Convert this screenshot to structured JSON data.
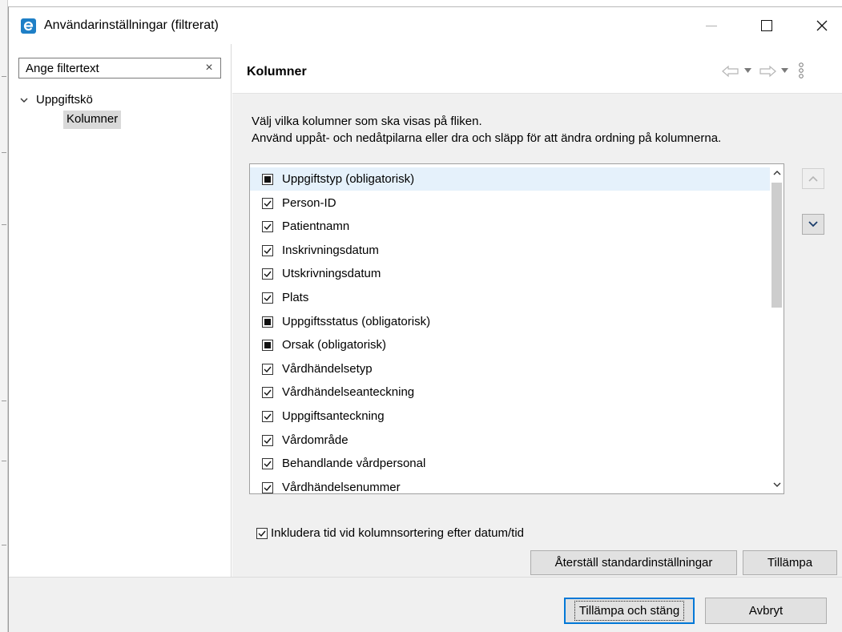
{
  "window": {
    "title": "Användarinställningar (filtrerat)",
    "accent_color": "#1e7fc6"
  },
  "sidebar": {
    "filter": {
      "value": "",
      "placeholder": "Ange filtertext",
      "clear_icon": "×"
    },
    "tree": {
      "root_label": "Uppgiftskö",
      "child_label": "Kolumner",
      "child_selected": true
    }
  },
  "page": {
    "title": "Kolumner",
    "description_line1": "Välj vilka kolumner som ska visas på fliken.",
    "description_line2": "Använd uppåt- och nedåtpilarna eller dra och släpp för att ändra ordning på kolumnerna."
  },
  "columns": [
    {
      "label": "Uppgiftstyp (obligatorisk)",
      "state": "mandatory",
      "selected": true
    },
    {
      "label": "Person-ID",
      "state": "checked",
      "selected": false
    },
    {
      "label": "Patientnamn",
      "state": "checked",
      "selected": false
    },
    {
      "label": "Inskrivningsdatum",
      "state": "checked",
      "selected": false
    },
    {
      "label": "Utskrivningsdatum",
      "state": "checked",
      "selected": false
    },
    {
      "label": "Plats",
      "state": "checked",
      "selected": false
    },
    {
      "label": "Uppgiftsstatus (obligatorisk)",
      "state": "mandatory",
      "selected": false
    },
    {
      "label": "Orsak (obligatorisk)",
      "state": "mandatory",
      "selected": false
    },
    {
      "label": "Vårdhändelsetyp",
      "state": "checked",
      "selected": false
    },
    {
      "label": "Vårdhändelseanteckning",
      "state": "checked",
      "selected": false
    },
    {
      "label": "Uppgiftsanteckning",
      "state": "checked",
      "selected": false
    },
    {
      "label": "Vårdområde",
      "state": "checked",
      "selected": false
    },
    {
      "label": "Behandlande vårdpersonal",
      "state": "checked",
      "selected": false
    },
    {
      "label": "Vårdhändelsenummer",
      "state": "checked",
      "selected": false
    }
  ],
  "options": {
    "include_time_label": "Inkludera tid vid kolumnsortering efter datum/tid",
    "include_time_checked": true
  },
  "buttons": {
    "restore_defaults": "Återställ standardinställningar",
    "apply": "Tillämpa",
    "apply_and_close": "Tillämpa och stäng",
    "cancel": "Avbryt"
  }
}
